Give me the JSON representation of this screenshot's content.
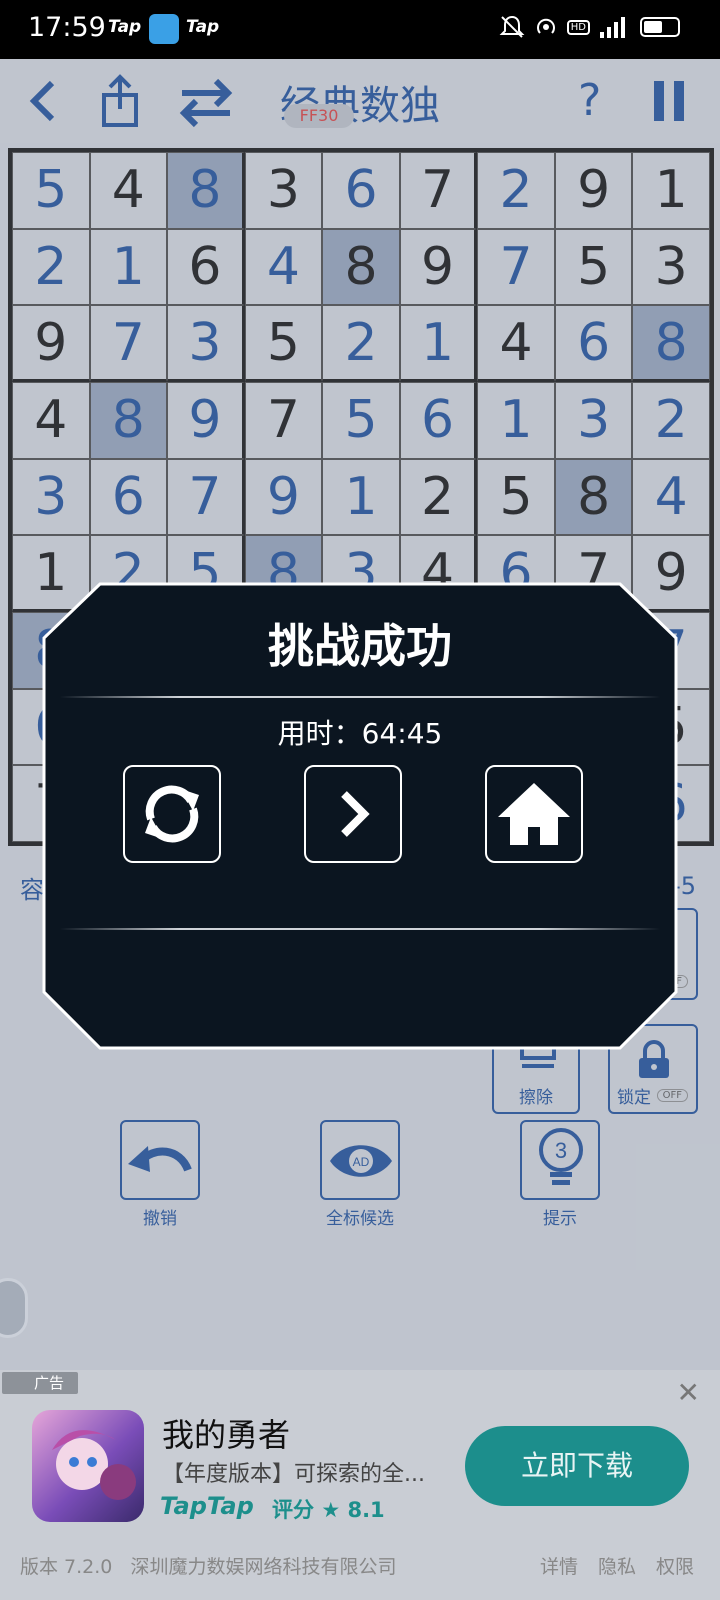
{
  "status_bar": {
    "time": "17:59",
    "tap_left": "Tap",
    "tap_right": "Tap"
  },
  "header": {
    "title": "经典数独",
    "badge": "FF30",
    "icons": [
      "back-icon",
      "share-icon",
      "swap-icon",
      "help-icon",
      "pause-icon"
    ]
  },
  "board": {
    "rows": [
      [
        "5",
        "4",
        "8",
        "3",
        "6",
        "7",
        "2",
        "9",
        "1"
      ],
      [
        "2",
        "1",
        "6",
        "4",
        "8",
        "9",
        "7",
        "5",
        "3"
      ],
      [
        "9",
        "7",
        "3",
        "5",
        "2",
        "1",
        "4",
        "6",
        "8"
      ],
      [
        "4",
        "8",
        "9",
        "7",
        "5",
        "6",
        "1",
        "3",
        "2"
      ],
      [
        "3",
        "6",
        "7",
        "9",
        "1",
        "2",
        "5",
        "8",
        "4"
      ],
      [
        "1",
        "2",
        "5",
        "8",
        "3",
        "4",
        "6",
        "7",
        "9"
      ],
      [
        "8",
        "",
        "",
        "",
        "",
        "",
        "",
        "",
        "7"
      ],
      [
        "6",
        "",
        "",
        "",
        "",
        "",
        "",
        "",
        "5"
      ],
      [
        "7",
        "",
        "",
        "",
        "",
        "",
        "",
        "",
        "6"
      ]
    ],
    "types": [
      [
        "u",
        "g",
        "u",
        "g",
        "u",
        "g",
        "u",
        "g",
        "g"
      ],
      [
        "u",
        "u",
        "g",
        "u",
        "g",
        "g",
        "u",
        "g",
        "g"
      ],
      [
        "g",
        "u",
        "u",
        "g",
        "u",
        "u",
        "g",
        "u",
        "u"
      ],
      [
        "g",
        "u",
        "u",
        "g",
        "u",
        "u",
        "u",
        "u",
        "u"
      ],
      [
        "u",
        "u",
        "u",
        "u",
        "u",
        "g",
        "g",
        "g",
        "u"
      ],
      [
        "g",
        "u",
        "u",
        "u",
        "u",
        "g",
        "u",
        "g",
        "g"
      ],
      [
        "u",
        "g",
        "g",
        "g",
        "g",
        "g",
        "g",
        "g",
        "u"
      ],
      [
        "u",
        "g",
        "g",
        "g",
        "g",
        "g",
        "g",
        "g",
        "g"
      ],
      [
        "g",
        "g",
        "g",
        "g",
        "g",
        "g",
        "g",
        "g",
        "u"
      ]
    ],
    "highlight": [
      [
        0,
        2
      ],
      [
        1,
        4
      ],
      [
        2,
        8
      ],
      [
        3,
        1
      ],
      [
        4,
        7
      ],
      [
        5,
        3
      ],
      [
        6,
        0
      ]
    ]
  },
  "info": {
    "difficulty_partial": "容",
    "right_partial": "-5"
  },
  "tools": {
    "erase_label": "擦除",
    "lock_label": "锁定",
    "lock_state": "OFF",
    "hidden_state": "OFF",
    "undo_label": "撤销",
    "candidates_label": "全标候选",
    "candidates_badge": "AD",
    "hint_label": "提示",
    "hint_count": "3"
  },
  "modal": {
    "title": "挑战成功",
    "time_text": "用时：64:45",
    "buttons": [
      "restart-icon",
      "next-icon",
      "home-icon"
    ]
  },
  "ad": {
    "tag": "广告",
    "title": "我的勇者",
    "subtitle": "【年度版本】可探索的全...",
    "brand": "TapTap",
    "rating_label": "评分",
    "rating": "8.1",
    "cta": "立即下载"
  },
  "footer": {
    "version": "版本 7.2.0",
    "company": "深圳魔力数娱网络科技有限公司",
    "links": [
      "详情",
      "隐私",
      "权限"
    ]
  },
  "colors": {
    "user_digit": "#1a4a93",
    "modal_bg": "#0b1520",
    "cta": "#1c8e8c"
  }
}
